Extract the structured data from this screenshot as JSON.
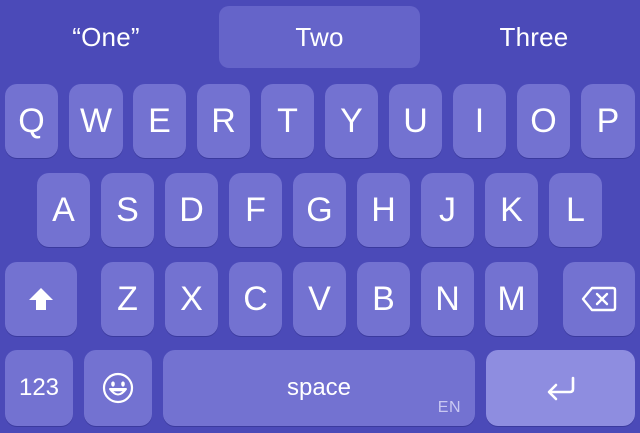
{
  "suggestions": [
    "“One”",
    "Two",
    "Three"
  ],
  "rows": {
    "row1": [
      "Q",
      "W",
      "E",
      "R",
      "T",
      "Y",
      "U",
      "I",
      "O",
      "P"
    ],
    "row2": [
      "A",
      "S",
      "D",
      "F",
      "G",
      "H",
      "J",
      "K",
      "L"
    ],
    "row3": [
      "Z",
      "X",
      "C",
      "V",
      "B",
      "N",
      "M"
    ]
  },
  "bottom": {
    "numbers_label": "123",
    "space_label": "space",
    "language_code": "EN"
  },
  "icons": {
    "shift": "shift-icon",
    "delete": "delete-icon",
    "emoji": "emoji-icon",
    "return": "return-icon"
  },
  "colors": {
    "background": "#4b4ab8",
    "key": "#7372d1",
    "return_key": "#8e8de0",
    "selected_suggestion": "#6564c9"
  }
}
